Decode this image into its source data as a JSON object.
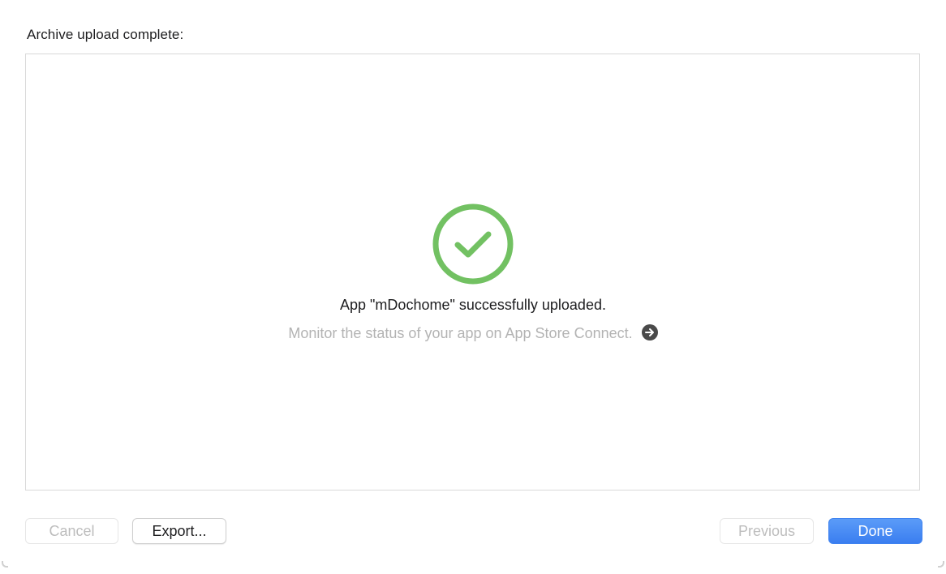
{
  "header": {
    "title": "Archive upload complete:"
  },
  "status": {
    "icon": "checkmark-circle-icon",
    "icon_color": "#72c162",
    "message": "App \"mDochome\" successfully uploaded.",
    "link_text": "Monitor the status of your app on App Store Connect.",
    "link_icon": "arrow-right-circle-icon"
  },
  "footer": {
    "cancel_label": "Cancel",
    "export_label": "Export...",
    "previous_label": "Previous",
    "done_label": "Done"
  },
  "colors": {
    "accent": "#3a7ef0",
    "success": "#72c162"
  }
}
